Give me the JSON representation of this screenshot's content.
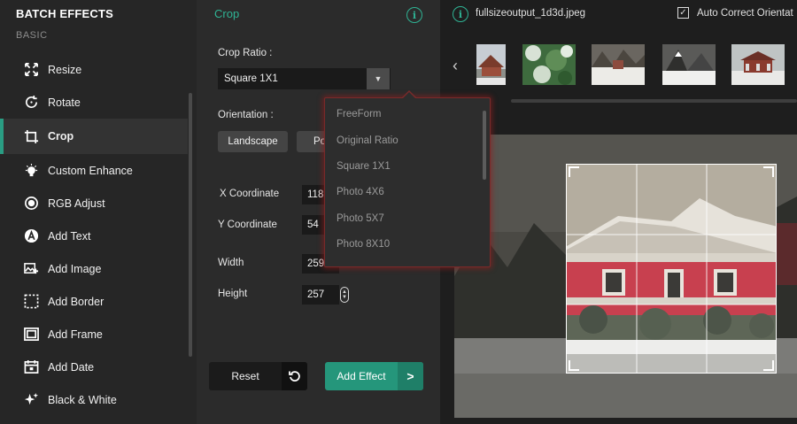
{
  "sidebar": {
    "app_title": "BATCH EFFECTS",
    "section": "BASIC",
    "items": [
      {
        "label": "Resize",
        "icon": "resize-icon"
      },
      {
        "label": "Rotate",
        "icon": "rotate-icon"
      },
      {
        "label": "Crop",
        "icon": "crop-icon",
        "active": true
      },
      {
        "label": "Custom Enhance",
        "icon": "bulb-icon"
      },
      {
        "label": "RGB Adjust",
        "icon": "rgb-icon"
      },
      {
        "label": "Add Text",
        "icon": "text-icon"
      },
      {
        "label": "Add Image",
        "icon": "add-image-icon"
      },
      {
        "label": "Add Border",
        "icon": "border-icon"
      },
      {
        "label": "Add Frame",
        "icon": "frame-icon"
      },
      {
        "label": "Add Date",
        "icon": "calendar-icon"
      },
      {
        "label": "Black & White",
        "icon": "sparkle-icon"
      }
    ]
  },
  "panel": {
    "title": "Crop",
    "crop_ratio_label": "Crop Ratio :",
    "crop_ratio_value": "Square 1X1",
    "orientation_label": "Orientation :",
    "orientation_options": [
      "Landscape",
      "Po"
    ],
    "x_label": "X Coordinate",
    "x_value": "118",
    "y_label": "Y Coordinate",
    "y_value": "54",
    "width_label": "Width",
    "width_value": "259",
    "height_label": "Height",
    "height_value": "257",
    "reset_label": "Reset",
    "add_effect_label": "Add Effect"
  },
  "dropdown": {
    "options": [
      "FreeForm",
      "Original Ratio",
      "Square 1X1",
      "Photo 4X6",
      "Photo 5X7",
      "Photo 8X10"
    ]
  },
  "preview": {
    "file_name": "fullsizeoutput_1d3d.jpeg",
    "auto_correct_label": "Auto Correct Orientat",
    "auto_correct_checked": true
  },
  "colors": {
    "accent": "#2fb394",
    "button_green": "#25967b",
    "sidebar_bg": "#262626",
    "panel_bg": "#2b2b2b"
  }
}
